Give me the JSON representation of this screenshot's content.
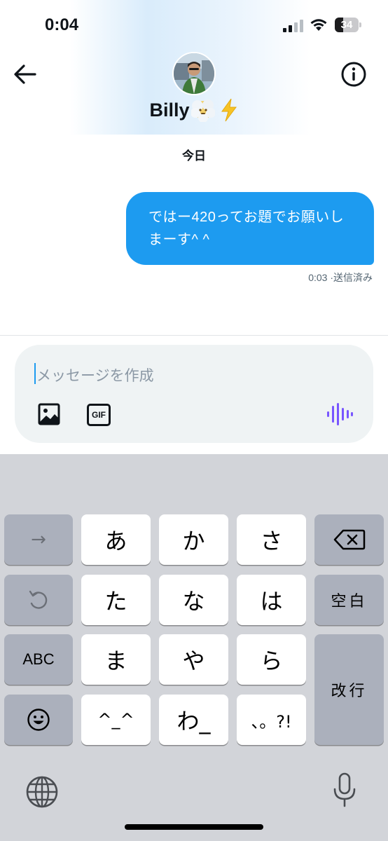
{
  "status_bar": {
    "time": "0:04",
    "battery_level": "34",
    "battery_fraction": 0.34
  },
  "header": {
    "back_icon": "arrow-left-icon",
    "contact_name": "Billy",
    "name_emojis": [
      "face-in-clouds-emoji",
      "high-voltage-emoji"
    ],
    "info_icon": "info-icon"
  },
  "conversation": {
    "date_label": "今日",
    "messages": [
      {
        "text": "ではー420ってお題でお願いしまーす^ ^",
        "time": "0:03",
        "status": "·送信済み",
        "direction": "outgoing"
      }
    ]
  },
  "composer": {
    "placeholder": "メッセージを作成",
    "gif_label": "GIF",
    "icons": [
      "image-icon",
      "gif-icon",
      "voice-waveform-icon"
    ]
  },
  "keyboard": {
    "rows": [
      [
        "→",
        "あ",
        "か",
        "さ",
        "⌫"
      ],
      [
        "↺",
        "た",
        "な",
        "は",
        "空白"
      ],
      [
        "ABC",
        "ま",
        "や",
        "ら",
        "改行"
      ],
      [
        "☺",
        "^_^",
        "わ_",
        "、。?!"
      ]
    ],
    "labels": {
      "arrow": "→",
      "a": "あ",
      "ka": "か",
      "sa": "さ",
      "ta": "た",
      "na": "な",
      "ha": "は",
      "space": "空白",
      "abc": "ABC",
      "ma": "ま",
      "ya": "や",
      "ra": "ら",
      "enter": "改行",
      "kaomoji": "^_^",
      "wa": "わ_",
      "punct": "、。?!"
    }
  },
  "colors": {
    "accent": "#1d9bf0",
    "voice": "#7856ff",
    "keyboard_bg": "#d2d4d9"
  }
}
